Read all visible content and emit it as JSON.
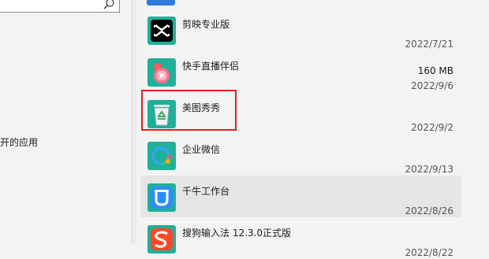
{
  "search": {
    "placeholder": ""
  },
  "left_nav": {
    "partial_label": "开的应用"
  },
  "apps": [
    {
      "name": "剪映专业版",
      "size": "",
      "date": "2022/7/21",
      "icon": "capcut-icon"
    },
    {
      "name": "快手直播伴侣",
      "size": "160 MB",
      "date": "2022/9/6",
      "icon": "kuaishou-live-icon"
    },
    {
      "name": "美图秀秀",
      "size": "",
      "date": "2022/9/2",
      "icon": "meitu-recycle-icon"
    },
    {
      "name": "企业微信",
      "size": "",
      "date": "2022/9/13",
      "icon": "wecom-icon"
    },
    {
      "name": "千牛工作台",
      "size": "",
      "date": "2022/8/26",
      "icon": "qianniu-icon",
      "selected": true
    },
    {
      "name": "搜狗输入法 12.3.0正式版",
      "size": "",
      "date": "2022/8/22",
      "icon": "sogou-icon"
    }
  ],
  "colors": {
    "accent_blue": "#2f7be0",
    "highlight_red": "#e02020",
    "icon_teal_bg": "#1fb09a",
    "selected_row": "#e5e5e5"
  }
}
